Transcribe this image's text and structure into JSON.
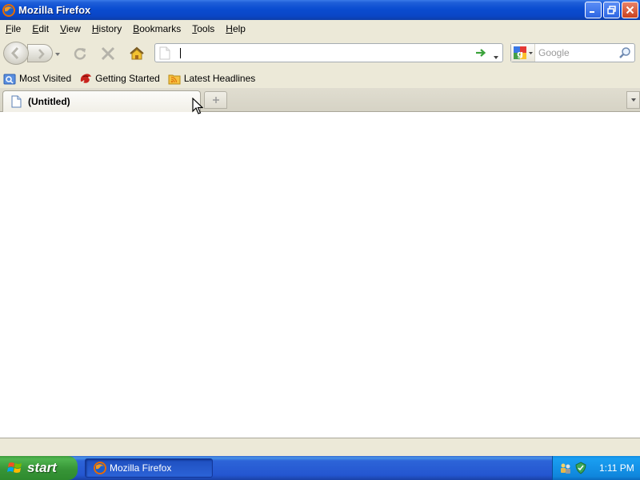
{
  "window": {
    "title": "Mozilla Firefox",
    "icon": "firefox-icon"
  },
  "menubar": {
    "items": [
      {
        "first": "F",
        "rest": "ile"
      },
      {
        "first": "E",
        "rest": "dit"
      },
      {
        "first": "V",
        "rest": "iew"
      },
      {
        "first": "H",
        "rest": "istory"
      },
      {
        "first": "B",
        "rest": "ookmarks"
      },
      {
        "first": "T",
        "rest": "ools"
      },
      {
        "first": "H",
        "rest": "elp"
      }
    ]
  },
  "navbar": {
    "url_value": "",
    "search_placeholder": "Google",
    "search_engine_icon": "google-icon"
  },
  "bookmarks": {
    "items": [
      {
        "label": "Most Visited",
        "icon": "smart-folder-icon"
      },
      {
        "label": "Getting Started",
        "icon": "firefox-red-icon"
      },
      {
        "label": "Latest Headlines",
        "icon": "rss-feed-icon"
      }
    ]
  },
  "tabs": {
    "active_label": "(Untitled)"
  },
  "taskbar": {
    "start_label": "start",
    "task_label": "Mozilla Firefox",
    "clock": "1:11 PM"
  },
  "colors": {
    "titlebar": "#0a46c6",
    "chrome": "#ece9d8",
    "taskbar": "#2456d0",
    "start_button": "#379537",
    "tray": "#0f86dc"
  }
}
